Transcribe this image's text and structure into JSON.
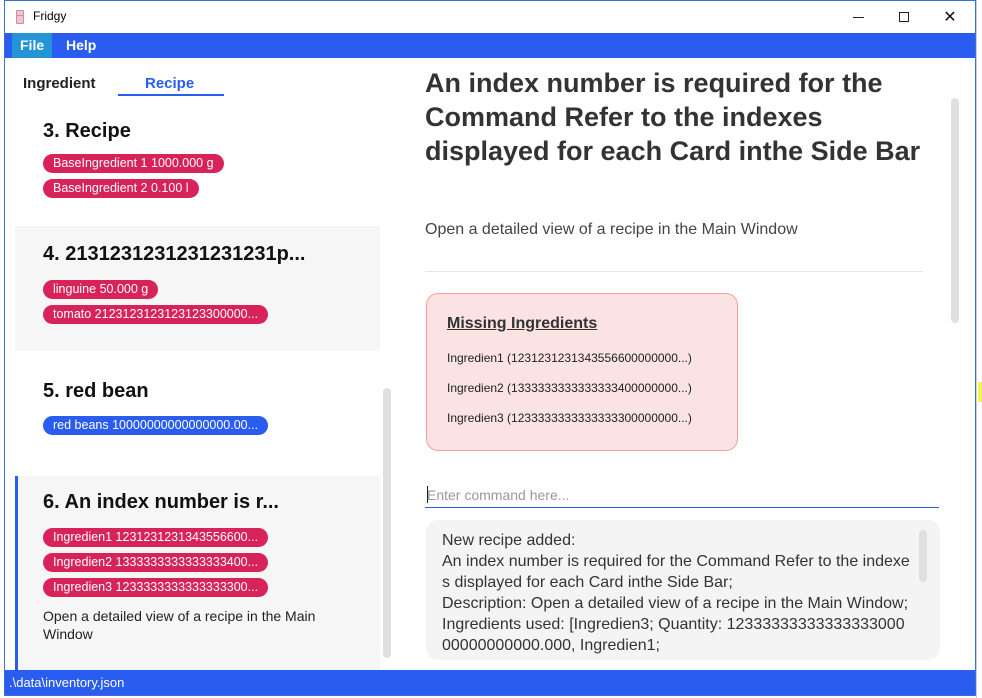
{
  "window": {
    "title": "Fridgy",
    "minimize_label": "",
    "maximize_label": "",
    "close_label": "✕"
  },
  "menu": {
    "file": "File",
    "help": "Help"
  },
  "tabs": {
    "ingredient": "Ingredient",
    "recipe": "Recipe"
  },
  "recipes": [
    {
      "title": "3.  Recipe",
      "tags": [
        "BaseIngredient 1 1000.000 g",
        "BaseIngredient 2 0.100 l"
      ]
    },
    {
      "title": "4.  2131231231231231231p...",
      "tags": [
        "linguine 50.000 g",
        "tomato 2123123123123123300000..."
      ]
    },
    {
      "title": "5.  red bean",
      "tags": [
        "red beans 10000000000000000.00..."
      ]
    },
    {
      "title": "6.  An index number is r...",
      "tags": [
        "Ingredien1 1231231231343556600...",
        "Ingredien2 1333333333333333400...",
        "Ingredien3 1233333333333333300..."
      ],
      "description": "Open a detailed view of a recipe in the Main Window"
    }
  ],
  "detail": {
    "title": "An index number is required for the Command Refer to the indexes displayed for each Card inthe Side Bar",
    "description": "Open a detailed view of a recipe in the Main Window",
    "missing_title": "Missing Ingredients",
    "missing_items": [
      "Ingredien1 (1231231231343556600000000...)",
      "Ingredien2 (1333333333333333400000000...)",
      "Ingredien3 (1233333333333333300000000...)"
    ]
  },
  "command": {
    "placeholder": "Enter command here..."
  },
  "result": {
    "text": "New recipe added:\nAn index number is required for the Command Refer to the indexes displayed for each Card inthe Side Bar;\nDescription: Open a detailed view of a recipe in the Main Window; Ingredients used: [Ingredien3; Quantity: 1233333333333333300000000000000.000, Ingredien1;"
  },
  "status": {
    "path": ".\\data\\inventory.json"
  },
  "colors": {
    "accent": "#2a5cf0",
    "tag_red": "#d8225a",
    "missing_bg": "#fbe3e3",
    "missing_border": "#f2a29b"
  }
}
